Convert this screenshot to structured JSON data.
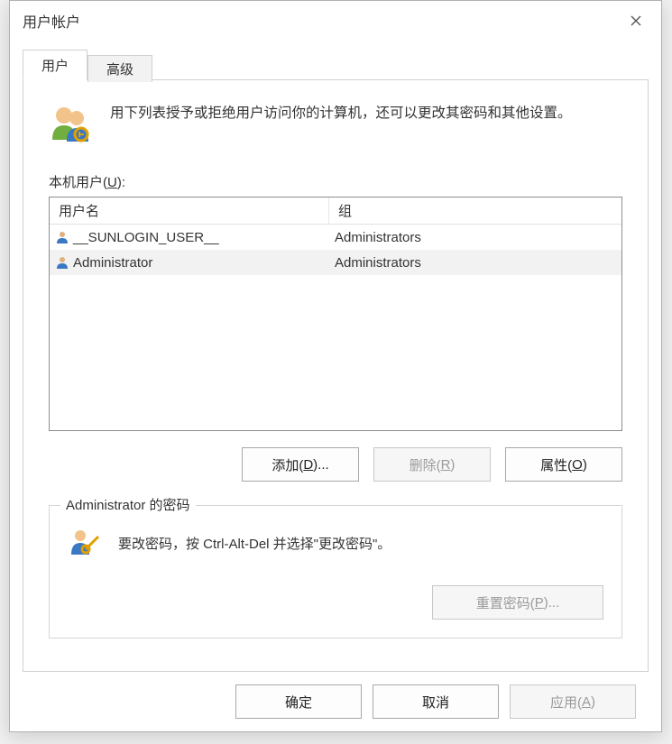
{
  "window": {
    "title": "用户帐户"
  },
  "tabs": {
    "users": "用户",
    "advanced": "高级"
  },
  "intro": "用下列表授予或拒绝用户访问你的计算机，还可以更改其密码和其他设置。",
  "listLabel": {
    "text": "本机用户(",
    "mn": "U",
    "suffix": "):"
  },
  "columns": {
    "name": "用户名",
    "group": "组"
  },
  "rows": [
    {
      "name": "__SUNLOGIN_USER__",
      "group": "Administrators",
      "selected": false
    },
    {
      "name": "Administrator",
      "group": "Administrators",
      "selected": true
    }
  ],
  "buttons": {
    "add": {
      "pre": "添加(",
      "mn": "D",
      "post": ")..."
    },
    "remove": {
      "pre": "删除(",
      "mn": "R",
      "post": ")"
    },
    "properties": {
      "pre": "属性(",
      "mn": "O",
      "post": ")"
    },
    "reset": {
      "pre": "重置密码(",
      "mn": "P",
      "post": ")..."
    },
    "ok": "确定",
    "cancel": "取消",
    "apply": {
      "pre": "应用(",
      "mn": "A",
      "post": ")"
    }
  },
  "passwordBox": {
    "legend": "Administrator 的密码",
    "hint": "要改密码，按 Ctrl-Alt-Del 并选择\"更改密码\"。"
  }
}
